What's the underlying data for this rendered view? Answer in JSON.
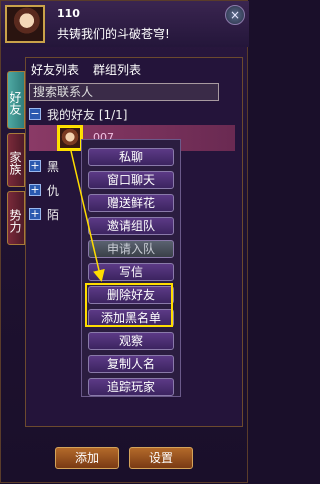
{
  "header": {
    "level": "110",
    "motto": "共铸我们的斗破苍穹!",
    "close_label": "×"
  },
  "side_tabs": [
    {
      "label": "好友",
      "active": true
    },
    {
      "label": "家族",
      "active": false
    },
    {
      "label": "势力",
      "active": false
    }
  ],
  "sub_tabs": [
    "好友列表",
    "群组列表"
  ],
  "search": {
    "placeholder": "搜索联系人"
  },
  "groups": [
    {
      "toggle": "−",
      "label": "我的好友 [1/1]"
    },
    {
      "toggle": "+",
      "label": "黑"
    },
    {
      "toggle": "+",
      "label": "仇"
    },
    {
      "toggle": "+",
      "label": "陌"
    }
  ],
  "friend": {
    "name": "007"
  },
  "context_menu": [
    {
      "label": "私聊",
      "disabled": false
    },
    {
      "label": "窗口聊天",
      "disabled": false
    },
    {
      "label": "赠送鲜花",
      "disabled": false
    },
    {
      "label": "邀请组队",
      "disabled": false
    },
    {
      "label": "申请入队",
      "disabled": true
    },
    {
      "label": "写信",
      "disabled": false
    },
    {
      "label": "删除好友",
      "disabled": false
    },
    {
      "label": "添加黑名单",
      "disabled": false
    },
    {
      "label": "观察",
      "disabled": false
    },
    {
      "label": "复制人名",
      "disabled": false
    },
    {
      "label": "追踪玩家",
      "disabled": false
    }
  ],
  "footer": {
    "add_label": "添加",
    "settings_label": "设置"
  },
  "colors": {
    "highlight": "#ffdd00",
    "accent": "#4fa9a3"
  }
}
